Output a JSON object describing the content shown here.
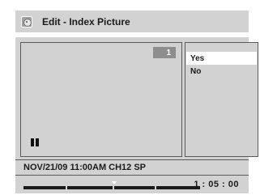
{
  "header": {
    "title": "Edit - Index Picture",
    "icon": "disc-icon"
  },
  "preview": {
    "index_number": "1",
    "status_icon": "pause-icon"
  },
  "menu": {
    "items": [
      {
        "label": "Yes",
        "selected": true
      },
      {
        "label": "No",
        "selected": false
      }
    ]
  },
  "info": {
    "recording": "NOV/21/09 11:00AM CH12 SP"
  },
  "playback": {
    "time": "1 : 05 : 00",
    "segments": 4
  },
  "colors": {
    "panel": "#d2d2d2",
    "highlight": "#ffffff",
    "badge": "#8e8e8e",
    "track": "#1a1a1a"
  }
}
